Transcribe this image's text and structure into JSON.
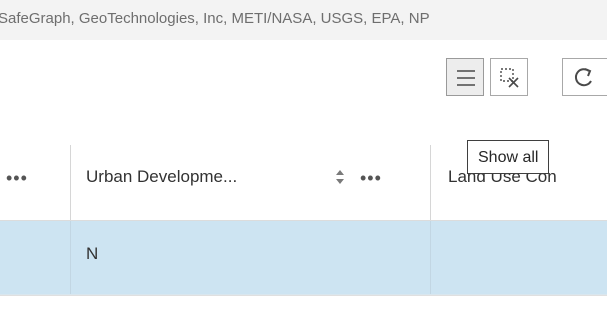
{
  "attribution": "SafeGraph, GeoTechnologies, Inc, METI/NASA, USGS, EPA, NP",
  "toolbar": {
    "buttons": [
      {
        "name": "hamburger-menu-icon"
      },
      {
        "name": "clear-selection-icon"
      },
      {
        "name": "refresh-icon"
      }
    ]
  },
  "tooltip": "Show all",
  "table": {
    "columns": [
      {
        "label": "",
        "menu": "•••"
      },
      {
        "label": "Urban Developme...",
        "menu": "•••"
      },
      {
        "label": "Land Use Con"
      }
    ],
    "rows": [
      {
        "cells": [
          "",
          "N",
          ""
        ],
        "selected": true
      }
    ]
  }
}
